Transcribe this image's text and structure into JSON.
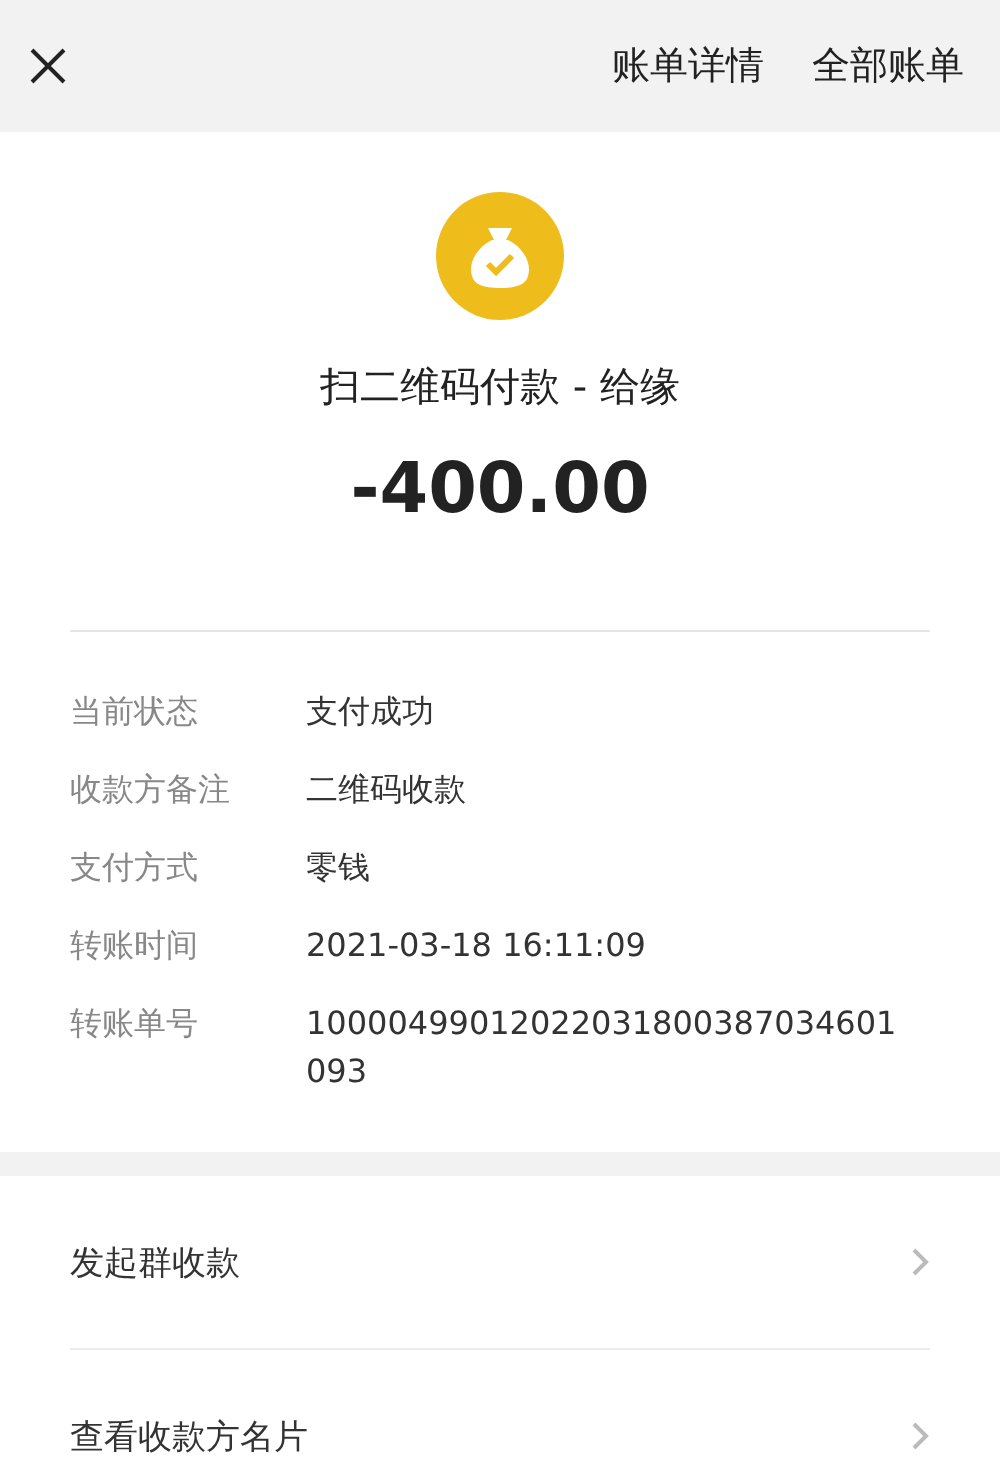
{
  "header": {
    "title": "账单详情",
    "action": "全部账单"
  },
  "payment": {
    "title": "扫二维码付款 - 给缘",
    "amount": "-400.00"
  },
  "details": [
    {
      "label": "当前状态",
      "value": "支付成功"
    },
    {
      "label": "收款方备注",
      "value": "二维码收款"
    },
    {
      "label": "支付方式",
      "value": "零钱"
    },
    {
      "label": "转账时间",
      "value": "2021-03-18 16:11:09"
    },
    {
      "label": "转账单号",
      "value": "10000499012022031800387034601093"
    }
  ],
  "actions": [
    {
      "label": "发起群收款"
    },
    {
      "label": "查看收款方名片"
    }
  ]
}
